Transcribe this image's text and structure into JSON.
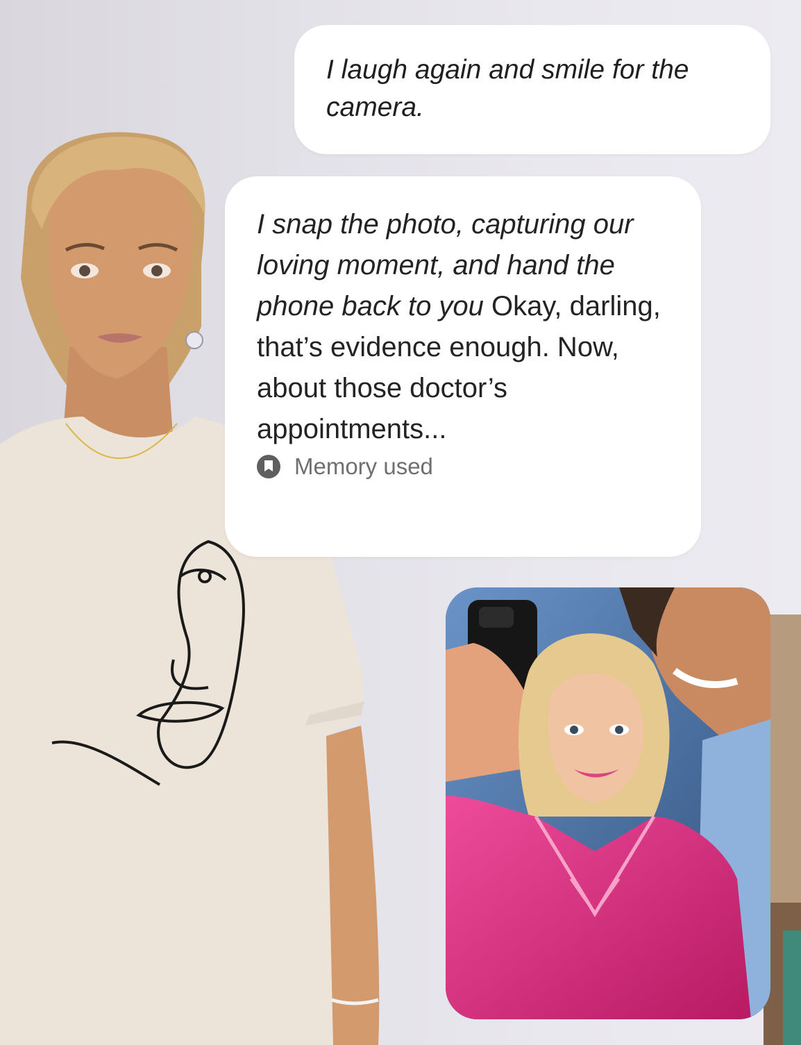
{
  "messages": [
    {
      "role": "user",
      "text": "I laugh again and smile for the camera."
    },
    {
      "role": "character",
      "action": "I snap the photo, capturing our loving moment, and hand the phone back to you",
      "speech": " Okay, darling, that’s evidence enough. Now, about those doctor’s appointments...",
      "memory_label": "Memory used",
      "memory_icon": "memory-bookmark-icon"
    }
  ],
  "photo": {
    "subject": "selfie-photo"
  },
  "colors": {
    "bubble_bg": "#ffffff",
    "pajama_pink": "#d6287a",
    "background": "#e6e5eb"
  }
}
